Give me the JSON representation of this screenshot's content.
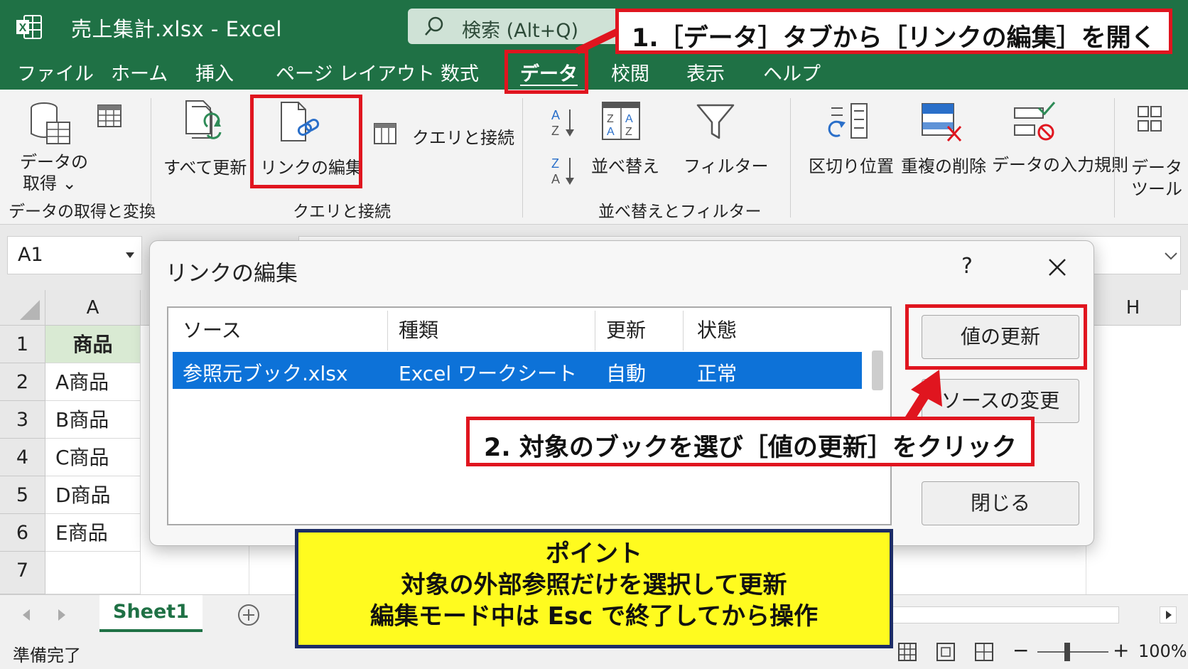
{
  "titlebar": {
    "title": "売上集計.xlsx  -  Excel",
    "search_text": "検索 (Alt+Q)"
  },
  "tabs": [
    "ファイル",
    "ホーム",
    "挿入",
    "ページ レイアウト",
    "数式",
    "データ",
    "校閲",
    "表示",
    "ヘルプ"
  ],
  "active_tab": "データ",
  "ribbon": {
    "get_data_line1": "データの",
    "get_data_line2": "取得 ⌄",
    "group_get_transform": "データの取得と変換",
    "refresh_all": "すべて更新",
    "edit_links": "リンクの編集",
    "queries_connections": "クエリと接続",
    "group_queries": "クエリと接続",
    "sort": "並べ替え",
    "filter": "フィルター",
    "group_sort_filter": "並べ替えとフィルター",
    "text_to_columns": "区切り位置",
    "remove_duplicates": "重複の削除",
    "data_validation": "データの入力規則",
    "data_tools_line1": "データ",
    "data_tools_line2": "ツール"
  },
  "formula_bar": {
    "name_box": "A1"
  },
  "grid": {
    "col_a": "A",
    "col_h": "H",
    "rows": [
      "1",
      "2",
      "3",
      "4",
      "5",
      "6",
      "7"
    ],
    "cells": [
      "商品",
      "A商品",
      "B商品",
      "C商品",
      "D商品",
      "E商品",
      ""
    ]
  },
  "sheet": {
    "tab": "Sheet1"
  },
  "status": {
    "ready": "準備完了",
    "zoom": "100%"
  },
  "dialog": {
    "title": "リンクの編集",
    "help": "?",
    "columns": [
      "ソース",
      "種類",
      "更新",
      "状態"
    ],
    "row": {
      "source": "参照元ブック.xlsx",
      "type": "Excel ワークシート",
      "update": "自動",
      "status": "正常"
    },
    "buttons": {
      "update_values": "値の更新",
      "change_source": "ソースの変更",
      "close": "閉じる"
    }
  },
  "annotations": {
    "step1": "1.［データ］タブから［リンクの編集］を開く",
    "step2": "2. 対象のブックを選び［値の更新］をクリック",
    "point_title": "ポイント",
    "point_line1": "対象の外部参照だけを選択して更新",
    "point_line2": "編集モード中は Esc で終了してから操作"
  },
  "colors": {
    "excel_green": "#1f7145",
    "selection_blue": "#0d72d8",
    "annotation_red": "#e0151f",
    "point_yellow": "#fffb1f"
  }
}
